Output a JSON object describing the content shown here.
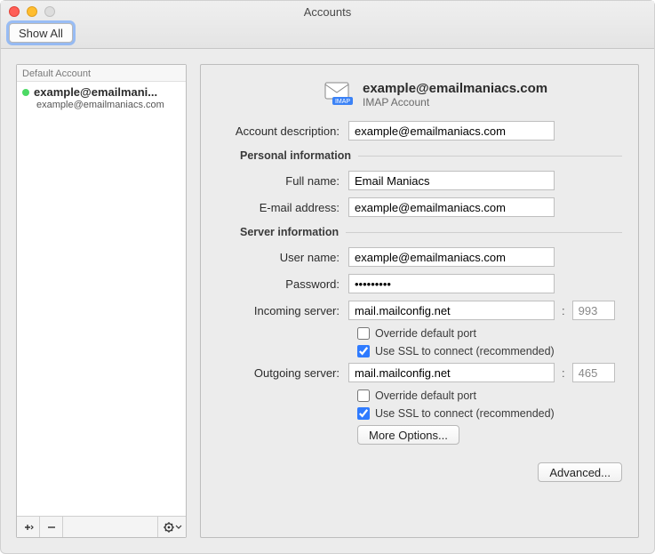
{
  "window": {
    "title": "Accounts",
    "show_all_label": "Show All"
  },
  "sidebar": {
    "header": "Default Account",
    "account": {
      "title": "example@emailmani...",
      "subtitle": "example@emailmaniacs.com"
    }
  },
  "details": {
    "header": {
      "title": "example@emailmaniacs.com",
      "subtitle": "IMAP Account",
      "badge": "IMAP"
    },
    "labels": {
      "description": "Account description:",
      "personal_section": "Personal information",
      "full_name": "Full name:",
      "email": "E-mail address:",
      "server_section": "Server information",
      "user_name": "User name:",
      "password": "Password:",
      "incoming": "Incoming server:",
      "outgoing": "Outgoing server:",
      "override_port": "Override default port",
      "use_ssl": "Use SSL to connect (recommended)",
      "more_options": "More Options...",
      "advanced": "Advanced..."
    },
    "values": {
      "description": "example@emailmaniacs.com",
      "full_name": "Email Maniacs",
      "email": "example@emailmaniacs.com",
      "user_name": "example@emailmaniacs.com",
      "password": "•••••••••",
      "incoming": "mail.mailconfig.net",
      "incoming_port": "993",
      "outgoing": "mail.mailconfig.net",
      "outgoing_port": "465"
    },
    "checks": {
      "incoming_override": false,
      "incoming_ssl": true,
      "outgoing_override": false,
      "outgoing_ssl": true
    }
  }
}
